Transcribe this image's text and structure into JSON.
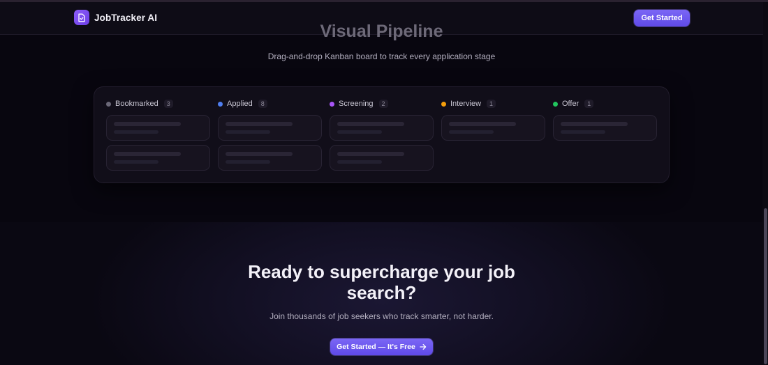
{
  "nav": {
    "brand_name": "JobTracker AI",
    "logo_icon": "document-icon",
    "cta_label": "Get Started"
  },
  "pipeline": {
    "title": "Visual Pipeline",
    "subtitle": "Drag-and-drop Kanban board to track every application stage",
    "columns": [
      {
        "name": "Bookmarked",
        "count": "3",
        "color": "#6b6878",
        "placeholder_cards": 2
      },
      {
        "name": "Applied",
        "count": "8",
        "color": "#4f7ef0",
        "placeholder_cards": 2
      },
      {
        "name": "Screening",
        "count": "2",
        "color": "#a855f7",
        "placeholder_cards": 2
      },
      {
        "name": "Interview",
        "count": "1",
        "color": "#f59e0b",
        "placeholder_cards": 1
      },
      {
        "name": "Offer",
        "count": "1",
        "color": "#22c55e",
        "placeholder_cards": 1
      }
    ]
  },
  "cta": {
    "title_line1": "Ready to supercharge your job",
    "title_line2": "search?",
    "subtitle": "Join thousands of job seekers who track smarter, not harder.",
    "button_label": "Get Started — It's Free",
    "button_icon": "arrow-right-icon"
  },
  "colors": {
    "accent": "#6b57f0",
    "background": "#08060f"
  }
}
